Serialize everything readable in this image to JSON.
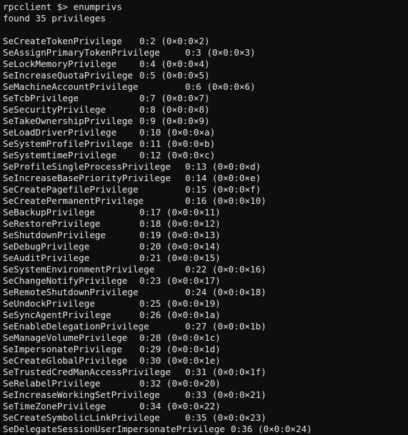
{
  "terminal": {
    "prompt": "rpcclient $> enumprivs",
    "summary": "found 35 privileges",
    "privileges": [
      {
        "name": "SeCreateTokenPrivilege",
        "value": "0:2 (0×0:0×2)"
      },
      {
        "name": "SeAssignPrimaryTokenPrivilege",
        "value": "0:3 (0×0:0×3)"
      },
      {
        "name": "SeLockMemoryPrivilege",
        "value": "0:4 (0×0:0×4)"
      },
      {
        "name": "SeIncreaseQuotaPrivilege",
        "value": "0:5 (0×0:0×5)"
      },
      {
        "name": "SeMachineAccountPrivilege",
        "value": "0:6 (0×0:0×6)"
      },
      {
        "name": "SeTcbPrivilege",
        "value": "0:7 (0×0:0×7)"
      },
      {
        "name": "SeSecurityPrivilege",
        "value": "0:8 (0×0:0×8)"
      },
      {
        "name": "SeTakeOwnershipPrivilege",
        "value": "0:9 (0×0:0×9)"
      },
      {
        "name": "SeLoadDriverPrivilege",
        "value": "0:10 (0×0:0×a)"
      },
      {
        "name": "SeSystemProfilePrivilege",
        "value": "0:11 (0×0:0×b)"
      },
      {
        "name": "SeSystemtimePrivilege",
        "value": "0:12 (0×0:0×c)"
      },
      {
        "name": "SeProfileSingleProcessPrivilege",
        "value": "0:13 (0×0:0×d)"
      },
      {
        "name": "SeIncreaseBasePriorityPrivilege",
        "value": "0:14 (0×0:0×e)"
      },
      {
        "name": "SeCreatePagefilePrivilege",
        "value": "0:15 (0×0:0×f)"
      },
      {
        "name": "SeCreatePermanentPrivilege",
        "value": "0:16 (0×0:0×10)"
      },
      {
        "name": "SeBackupPrivilege",
        "value": "0:17 (0×0:0×11)"
      },
      {
        "name": "SeRestorePrivilege",
        "value": "0:18 (0×0:0×12)"
      },
      {
        "name": "SeShutdownPrivilege",
        "value": "0:19 (0×0:0×13)"
      },
      {
        "name": "SeDebugPrivilege",
        "value": "0:20 (0×0:0×14)"
      },
      {
        "name": "SeAuditPrivilege",
        "value": "0:21 (0×0:0×15)"
      },
      {
        "name": "SeSystemEnvironmentPrivilege",
        "value": "0:22 (0×0:0×16)"
      },
      {
        "name": "SeChangeNotifyPrivilege",
        "value": "0:23 (0×0:0×17)"
      },
      {
        "name": "SeRemoteShutdownPrivilege",
        "value": "0:24 (0×0:0×18)"
      },
      {
        "name": "SeUndockPrivilege",
        "value": "0:25 (0×0:0×19)"
      },
      {
        "name": "SeSyncAgentPrivilege",
        "value": "0:26 (0×0:0×1a)"
      },
      {
        "name": "SeEnableDelegationPrivilege",
        "value": "0:27 (0×0:0×1b)"
      },
      {
        "name": "SeManageVolumePrivilege",
        "value": "0:28 (0×0:0×1c)"
      },
      {
        "name": "SeImpersonatePrivilege",
        "value": "0:29 (0×0:0×1d)"
      },
      {
        "name": "SeCreateGlobalPrivilege",
        "value": "0:30 (0×0:0×1e)"
      },
      {
        "name": "SeTrustedCredManAccessPrivilege",
        "value": "0:31 (0×0:0×1f)"
      },
      {
        "name": "SeRelabelPrivilege",
        "value": "0:32 (0×0:0×20)"
      },
      {
        "name": "SeIncreaseWorkingSetPrivilege",
        "value": "0:33 (0×0:0×21)"
      },
      {
        "name": "SeTimeZonePrivilege",
        "value": "0:34 (0×0:0×22)"
      },
      {
        "name": "SeCreateSymbolicLinkPrivilege",
        "value": "0:35 (0×0:0×23)"
      },
      {
        "name": "SeDelegateSessionUserImpersonatePrivilege",
        "value": "0:36 (0×0:0×24)"
      }
    ]
  }
}
